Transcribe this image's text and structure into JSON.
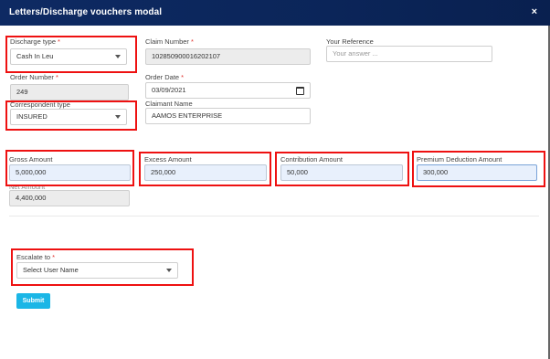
{
  "modal": {
    "title": "Letters/Discharge vouchers modal",
    "close_glyph": "×"
  },
  "fields": {
    "discharge_type": {
      "label": "Discharge type",
      "required_mark": "*",
      "value": "Cash In Leu"
    },
    "claim_number": {
      "label": "Claim Number",
      "required_mark": "*",
      "value": "102850900016202107"
    },
    "your_reference": {
      "label": "Your Reference",
      "placeholder": "Your answer ..."
    },
    "order_number": {
      "label": "Order Number",
      "required_mark": "*",
      "value": "249"
    },
    "order_date": {
      "label": "Order Date",
      "required_mark": "*",
      "value": "03/09/2021"
    },
    "correspondent_type": {
      "label": "Correspondent type",
      "value": "INSURED"
    },
    "claimant_name": {
      "label": "Claimant Name",
      "value": "AAMOS ENTERPRISE"
    },
    "gross_amount": {
      "label": "Gross Amount",
      "value": "5,000,000"
    },
    "excess_amount": {
      "label": "Excess Amount",
      "value": "250,000"
    },
    "contribution_amount": {
      "label": "Contribution Amount",
      "value": "50,000"
    },
    "premium_deduction_amount": {
      "label": "Premium Deduction Amount",
      "value": "300,000"
    },
    "net_amount": {
      "label": "Net Amount",
      "value": "4,400,000"
    },
    "escalate_to": {
      "label": "Escalate to",
      "required_mark": "*",
      "value": "Select User Name"
    }
  },
  "actions": {
    "submit_label": "Submit"
  },
  "colors": {
    "header": "#0e2a63",
    "highlight": "#ee1111",
    "submit": "#1bb6e6",
    "amount_field": "#e8f0fc"
  }
}
